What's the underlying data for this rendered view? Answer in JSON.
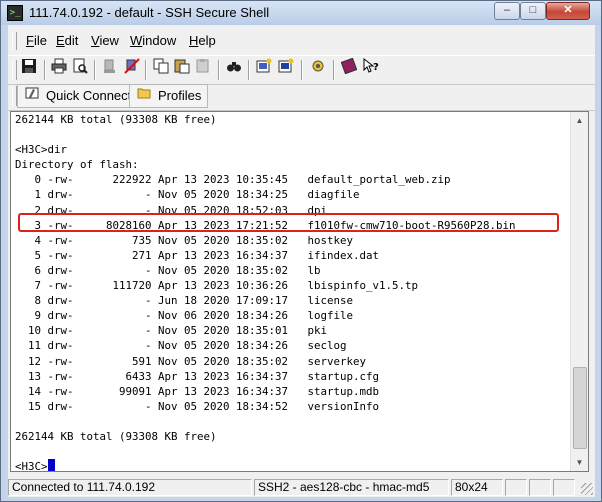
{
  "window": {
    "title": "111.74.0.192 - default - SSH Secure Shell",
    "controls": {
      "minimize": "–",
      "maximize": "□",
      "close": "✕"
    }
  },
  "menu": [
    "File",
    "Edit",
    "View",
    "Window",
    "Help"
  ],
  "toolbar": {
    "icons": [
      "save-icon",
      "print-icon",
      "print-preview-icon",
      "disconnect-icon",
      "connect-icon",
      "copy-icon",
      "paste-icon",
      "paste-disabled-icon",
      "find-icon",
      "profile-icon",
      "new-terminal-icon",
      "settings-icon",
      "help-book-icon",
      "whats-this-icon"
    ]
  },
  "shortcuts": {
    "quick_connect": "Quick Connect",
    "profiles": "Profiles"
  },
  "terminal": {
    "lines": [
      "262144 KB total (93308 KB free)",
      "",
      "<H3C>dir",
      "Directory of flash:",
      "   0 -rw-      222922 Apr 13 2023 10:35:45   default_portal_web.zip",
      "   1 drw-           - Nov 05 2020 18:34:25   diagfile",
      "   2 drw-           - Nov 05 2020 18:52:03   dpi",
      "   3 -rw-     8028160 Apr 13 2023 17:21:52   f1010fw-cmw710-boot-R9560P28.bin",
      "   4 -rw-         735 Nov 05 2020 18:35:02   hostkey",
      "   5 -rw-         271 Apr 13 2023 16:34:37   ifindex.dat",
      "   6 drw-           - Nov 05 2020 18:35:02   lb",
      "   7 -rw-      111720 Apr 13 2023 10:36:26   lbispinfo_v1.5.tp",
      "   8 drw-           - Jun 18 2020 17:09:17   license",
      "   9 drw-           - Nov 06 2020 18:34:26   logfile",
      "  10 drw-           - Nov 05 2020 18:35:01   pki",
      "  11 drw-           - Nov 05 2020 18:34:26   seclog",
      "  12 -rw-         591 Nov 05 2020 18:35:02   serverkey",
      "  13 -rw-        6433 Apr 13 2023 16:34:37   startup.cfg",
      "  14 -rw-       99091 Apr 13 2023 16:34:37   startup.mdb",
      "  15 drw-           - Nov 05 2020 18:34:52   versionInfo",
      "",
      "262144 KB total (93308 KB free)",
      ""
    ],
    "prompt": "<H3C>"
  },
  "status": {
    "connection": "Connected to 111.74.0.192",
    "encryption": "SSH2 - aes128-cbc - hmac-md5",
    "size": "80x24"
  },
  "colors": {
    "highlight_box": "#e0201a",
    "cursor": "#0000c8"
  }
}
